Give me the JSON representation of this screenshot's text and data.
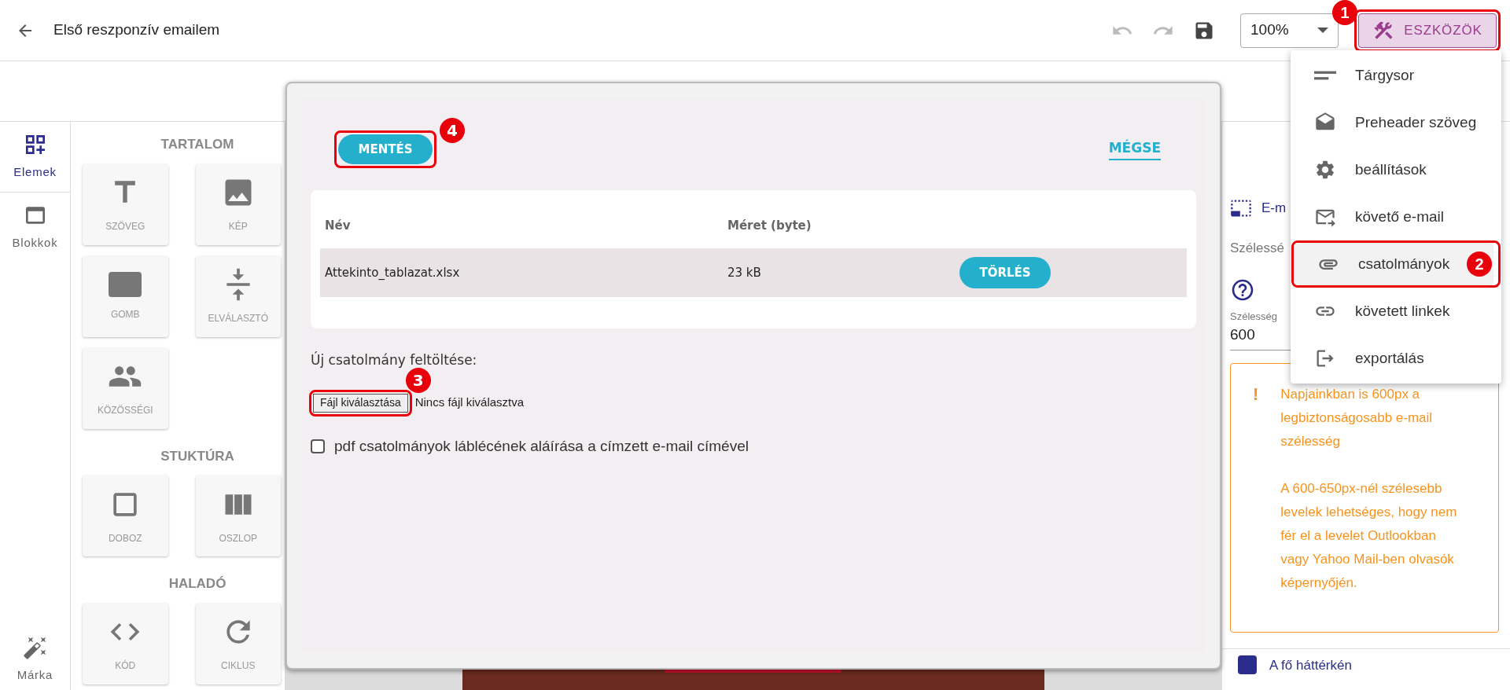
{
  "header": {
    "title": "Első reszponzív emailem",
    "zoom": "100%",
    "tools_button": {
      "label": "ESZKÖZÖK",
      "callout": "1"
    }
  },
  "tools_menu": [
    {
      "label": "Tárgysor",
      "selected": false
    },
    {
      "label": "Preheader szöveg",
      "selected": false
    },
    {
      "label": "beállítások",
      "selected": false
    },
    {
      "label": "követő e-mail",
      "selected": false
    },
    {
      "label": "csatolmányok",
      "selected": true,
      "callout": "2"
    },
    {
      "label": "követett linkek",
      "selected": false
    },
    {
      "label": "exportálás",
      "selected": false
    }
  ],
  "left_rail": {
    "tabs": [
      {
        "label": "Elemek",
        "selected": true
      },
      {
        "label": "Blokkok",
        "selected": false
      }
    ],
    "brand": "Márka"
  },
  "elements_panel": [
    {
      "title": "TARTALOM",
      "items": [
        "SZÖVEG",
        "KÉP",
        "GOMB",
        "ELVÁLASZTÓ",
        "KÖZÖSSÉGI"
      ]
    },
    {
      "title": "STUKTÚRA",
      "items": [
        "DOBOZ",
        "OSZLOP"
      ]
    },
    {
      "title": "HALADÓ",
      "items": [
        "KÓD",
        "CIKLUS"
      ]
    }
  ],
  "modal": {
    "save_button": {
      "label": "MENTÉS",
      "callout": "4"
    },
    "cancel_link": "MÉGSE",
    "table": {
      "columns": [
        "Név",
        "Méret (byte)"
      ],
      "rows": [
        {
          "name": "Attekinto_tablazat.xlsx",
          "size": "23 kB",
          "action": "TÖRLÉS"
        }
      ]
    },
    "upload_label": "Új csatolmány feltöltése:",
    "file_button": {
      "label": "Fájl kiválasztása",
      "callout": "3"
    },
    "file_status": "Nincs fájl kiválasztva",
    "checkbox": {
      "label": "pdf csatolmányok láblécének aláírása a címzett e-mail címével",
      "checked": false
    }
  },
  "right_panel": {
    "section_title": "E-m",
    "width_heading": "Szélessé",
    "width_field": {
      "label": "Szélesség",
      "value": "600"
    },
    "warning": {
      "mark": "!",
      "paragraphs": [
        "Napjainkban is 600px a legbiztonságosabb e-mail szélesség",
        "A 600-650px-nél szélesebb levelek lehetséges, hogy nem fér el a levelet Outlookban vagy Yahoo Mail-ben olvasók képernyőjén."
      ]
    },
    "footer_item": "A fő háttérkén"
  }
}
